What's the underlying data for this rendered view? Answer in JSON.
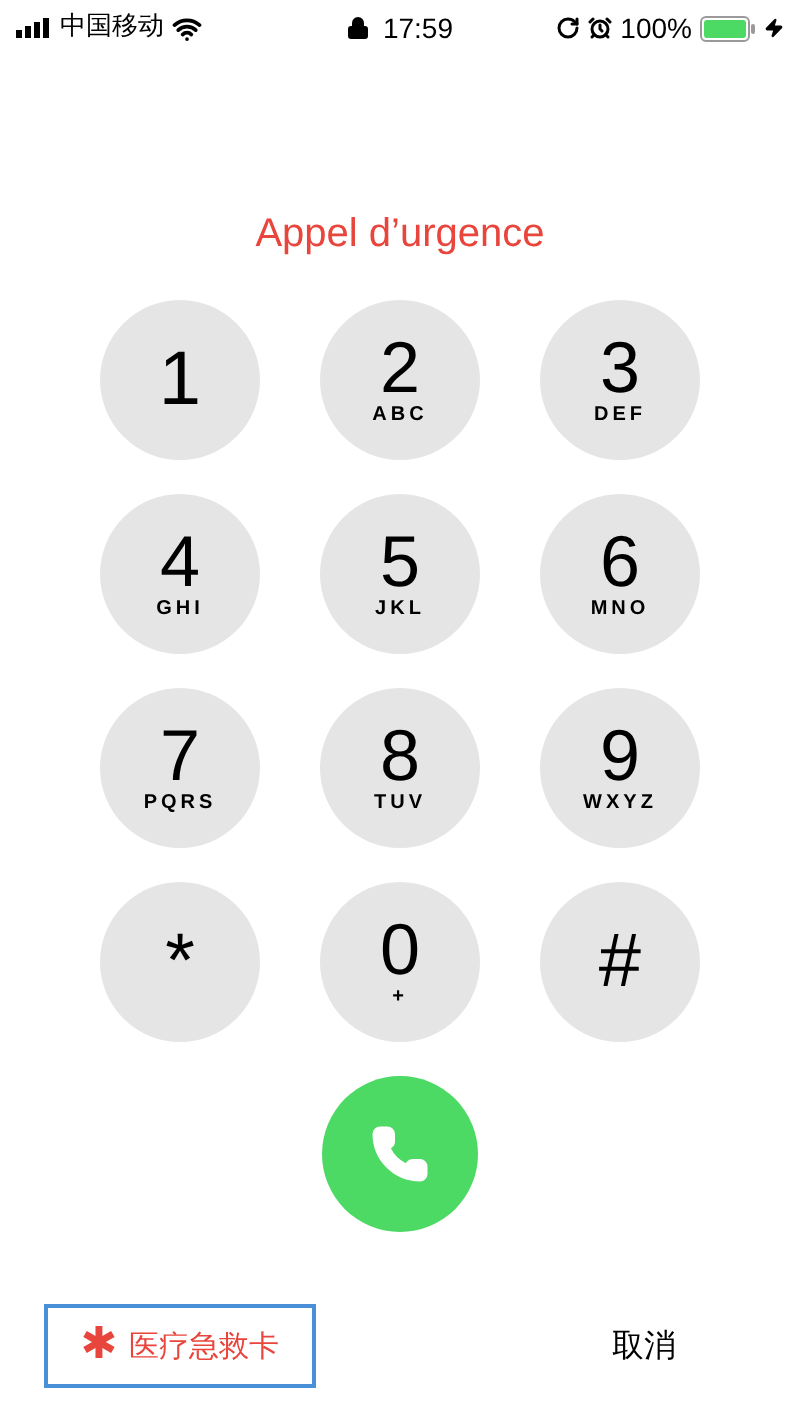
{
  "status_bar": {
    "carrier": "中国移动",
    "time": "17:59",
    "battery": "100%"
  },
  "title": "Appel d’urgence",
  "keys": [
    {
      "digit": "1"
    },
    {
      "digit": "2",
      "letters": "ABC"
    },
    {
      "digit": "3",
      "letters": "DEF"
    },
    {
      "digit": "4",
      "letters": "GHI"
    },
    {
      "digit": "5",
      "letters": "JKL"
    },
    {
      "digit": "6",
      "letters": "MNO"
    },
    {
      "digit": "7",
      "letters": "PQRS"
    },
    {
      "digit": "8",
      "letters": "TUV"
    },
    {
      "digit": "9",
      "letters": "WXYZ"
    },
    {
      "digit": "*"
    },
    {
      "digit": "0",
      "letters": "+"
    },
    {
      "digit": "#"
    }
  ],
  "medical_id": {
    "icon": "✱",
    "label": "医疗急救卡"
  },
  "cancel": "取消"
}
